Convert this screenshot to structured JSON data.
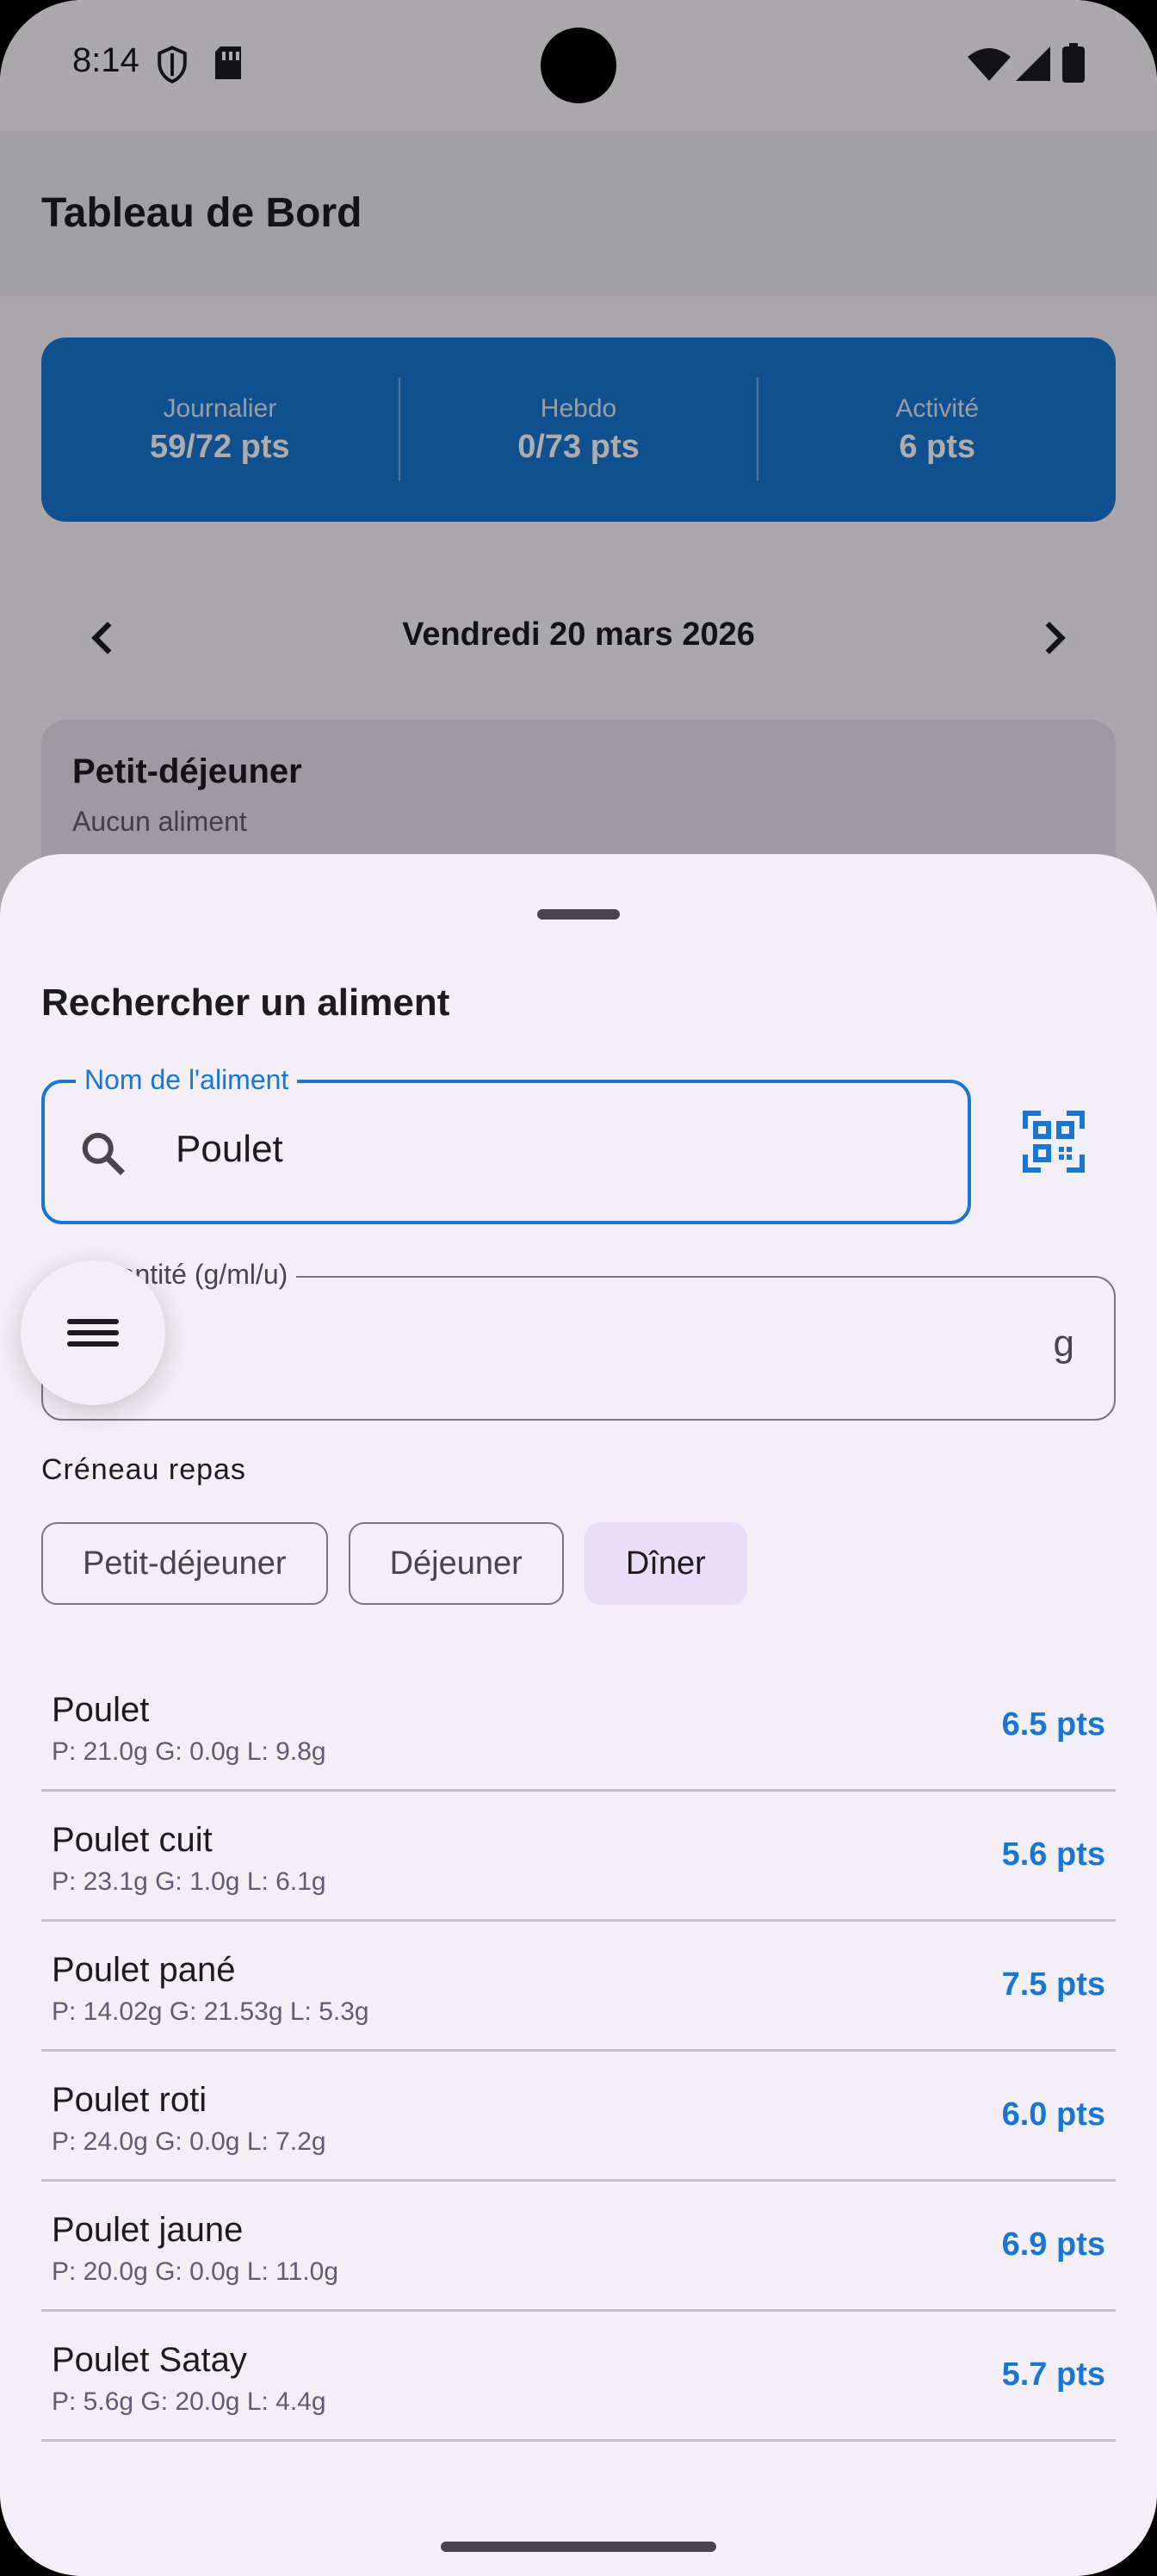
{
  "status_bar": {
    "time": "8:14"
  },
  "app_bar": {
    "title": "Tableau de Bord"
  },
  "summary": [
    {
      "label": "Journalier",
      "value": "59/72 pts"
    },
    {
      "label": "Hebdo",
      "value": "0/73 pts"
    },
    {
      "label": "Activité",
      "value": "6 pts"
    }
  ],
  "date_nav": {
    "date": "Vendredi 20 mars 2026"
  },
  "meal_card": {
    "title": "Petit-déjeuner",
    "subtitle": "Aucun aliment"
  },
  "sheet": {
    "title": "Rechercher un aliment",
    "search": {
      "label": "Nom de l'aliment",
      "value": "Poulet"
    },
    "quantity": {
      "label": "Quantité (g/ml/u)",
      "unit": "g"
    },
    "slot_label": "Créneau repas",
    "chips": [
      {
        "label": "Petit-déjeuner",
        "selected": false
      },
      {
        "label": "Déjeuner",
        "selected": false
      },
      {
        "label": "Dîner",
        "selected": true
      }
    ],
    "results": [
      {
        "name": "Poulet",
        "macros": "P: 21.0g  G: 0.0g  L: 9.8g",
        "points": "6.5 pts"
      },
      {
        "name": "Poulet cuit",
        "macros": "P: 23.1g  G: 1.0g  L: 6.1g",
        "points": "5.6 pts"
      },
      {
        "name": "Poulet pané",
        "macros": "P: 14.02g  G: 21.53g  L: 5.3g",
        "points": "7.5 pts"
      },
      {
        "name": "Poulet roti",
        "macros": "P: 24.0g  G: 0.0g  L: 7.2g",
        "points": "6.0 pts"
      },
      {
        "name": "Poulet jaune",
        "macros": "P: 20.0g  G: 0.0g  L: 11.0g",
        "points": "6.9 pts"
      },
      {
        "name": "Poulet Satay",
        "macros": "P: 5.6g  G: 20.0g  L: 4.4g",
        "points": "5.7 pts"
      }
    ]
  },
  "colors": {
    "primary": "#1976d2",
    "chip_selected": "#e8def8",
    "sheet_bg": "#f4eff7"
  },
  "icons": [
    "shield-icon",
    "sim-icon",
    "wifi-icon",
    "signal-icon",
    "battery-icon",
    "chevron-left-icon",
    "chevron-right-icon",
    "search-icon",
    "qr-scan-icon",
    "menu-icon"
  ]
}
